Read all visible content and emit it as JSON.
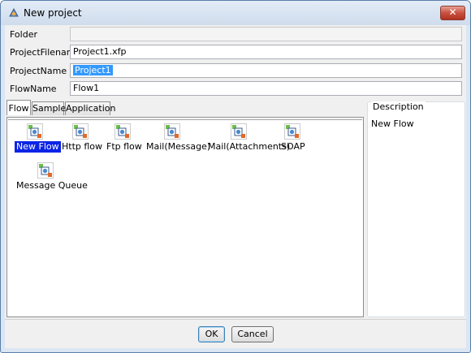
{
  "window": {
    "title": "New project",
    "close_label": "✕"
  },
  "form": {
    "folder_label": "Folder",
    "folder_value": "",
    "project_filename_label": "ProjectFilename",
    "project_filename_value": "Project1.xfp",
    "project_name_label": "ProjectName",
    "project_name_value": "Project1",
    "flow_name_label": "FlowName",
    "flow_name_value": "Flow1"
  },
  "tabs": [
    {
      "label": "Flow",
      "active": true
    },
    {
      "label": "Sample",
      "active": false
    },
    {
      "label": "Application",
      "active": false
    }
  ],
  "templates": [
    {
      "label": "New Flow",
      "selected": true,
      "icon": "flow-template-icon"
    },
    {
      "label": "Http flow",
      "selected": false,
      "icon": "flow-template-icon"
    },
    {
      "label": "Ftp flow",
      "selected": false,
      "icon": "flow-template-icon"
    },
    {
      "label": "Mail(Message)",
      "selected": false,
      "icon": "flow-template-icon"
    },
    {
      "label": "Mail(Attachments)",
      "selected": false,
      "icon": "flow-template-icon"
    },
    {
      "label": "SOAP",
      "selected": false,
      "icon": "flow-template-icon"
    },
    {
      "label": "Message Queue",
      "selected": false,
      "icon": "flow-template-icon"
    }
  ],
  "description": {
    "legend": "Description",
    "text": "New Flow"
  },
  "buttons": {
    "ok": "OK",
    "cancel": "Cancel"
  },
  "colors": {
    "selection": "#0a24e6",
    "text_selection": "#3399ff"
  }
}
